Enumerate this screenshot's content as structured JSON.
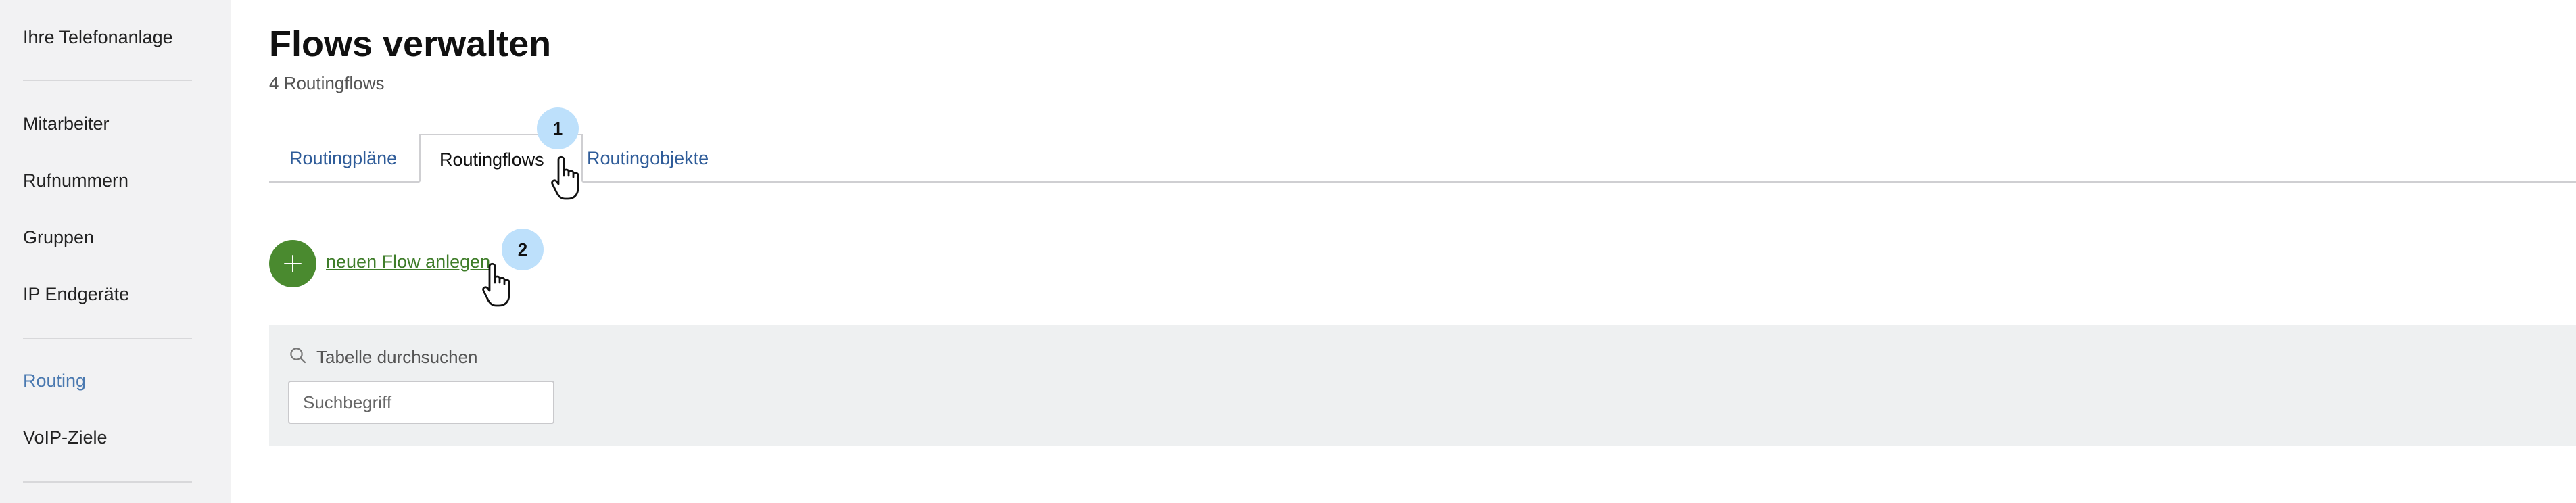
{
  "sidebar": {
    "items": [
      {
        "label": "Ihre Telefonanlage"
      },
      {
        "label": "Mitarbeiter"
      },
      {
        "label": "Rufnummern"
      },
      {
        "label": "Gruppen"
      },
      {
        "label": "IP Endgeräte"
      },
      {
        "label": "Routing",
        "active": true
      },
      {
        "label": "VoIP-Ziele"
      }
    ]
  },
  "header": {
    "title": "Flows verwalten",
    "subtitle": "4 Routingflows"
  },
  "tabs": [
    {
      "label": "Routingpläne"
    },
    {
      "label": "Routingflows",
      "active": true
    },
    {
      "label": "Routingobjekte"
    }
  ],
  "steps": {
    "step1": "1",
    "step2": "2"
  },
  "actions": {
    "add_flow_label": "neuen Flow anlegen"
  },
  "search": {
    "label": "Tabelle durchsuchen",
    "placeholder": "Suchbegriff",
    "value": ""
  },
  "colors": {
    "accent_blue": "#2f5c99",
    "active_sidebar": "#4a79b0",
    "add_green": "#4a8a2f",
    "badge_blue": "#bde0fb"
  }
}
